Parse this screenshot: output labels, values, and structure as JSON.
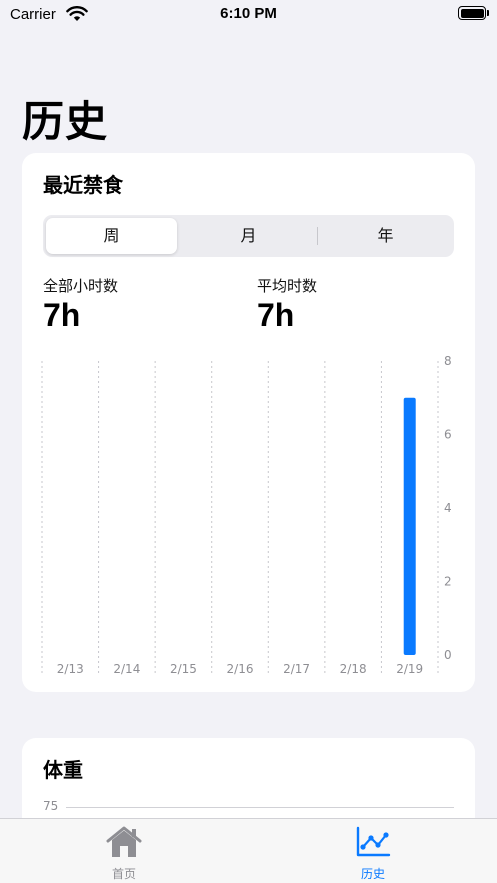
{
  "status_bar": {
    "carrier": "Carrier",
    "time": "6:10 PM"
  },
  "page": {
    "title": "历史"
  },
  "fasting_card": {
    "title": "最近禁食",
    "segments": [
      "周",
      "月",
      "年"
    ],
    "selected_segment": "周",
    "stats": [
      {
        "label": "全部小时数",
        "value": "7h"
      },
      {
        "label": "平均时数",
        "value": "7h"
      }
    ]
  },
  "weight_card": {
    "title": "体重",
    "y_tick": "75"
  },
  "tab_bar": {
    "tabs": [
      {
        "label": "首页",
        "icon": "house-icon",
        "active": false
      },
      {
        "label": "历史",
        "icon": "chart-line-icon",
        "active": true
      }
    ]
  },
  "colors": {
    "accent": "#0a7aff",
    "inactive_tab": "#8e8e93",
    "background": "#f2f2f7"
  },
  "chart_data": {
    "type": "bar",
    "categories": [
      "2/13",
      "2/14",
      "2/15",
      "2/16",
      "2/17",
      "2/18",
      "2/19"
    ],
    "values": [
      0,
      0,
      0,
      0,
      0,
      0,
      7
    ],
    "ylim": [
      0,
      8
    ],
    "yticks": [
      0,
      2,
      4,
      6,
      8
    ],
    "grid": "vertical dashed",
    "color": "#0a7aff"
  }
}
